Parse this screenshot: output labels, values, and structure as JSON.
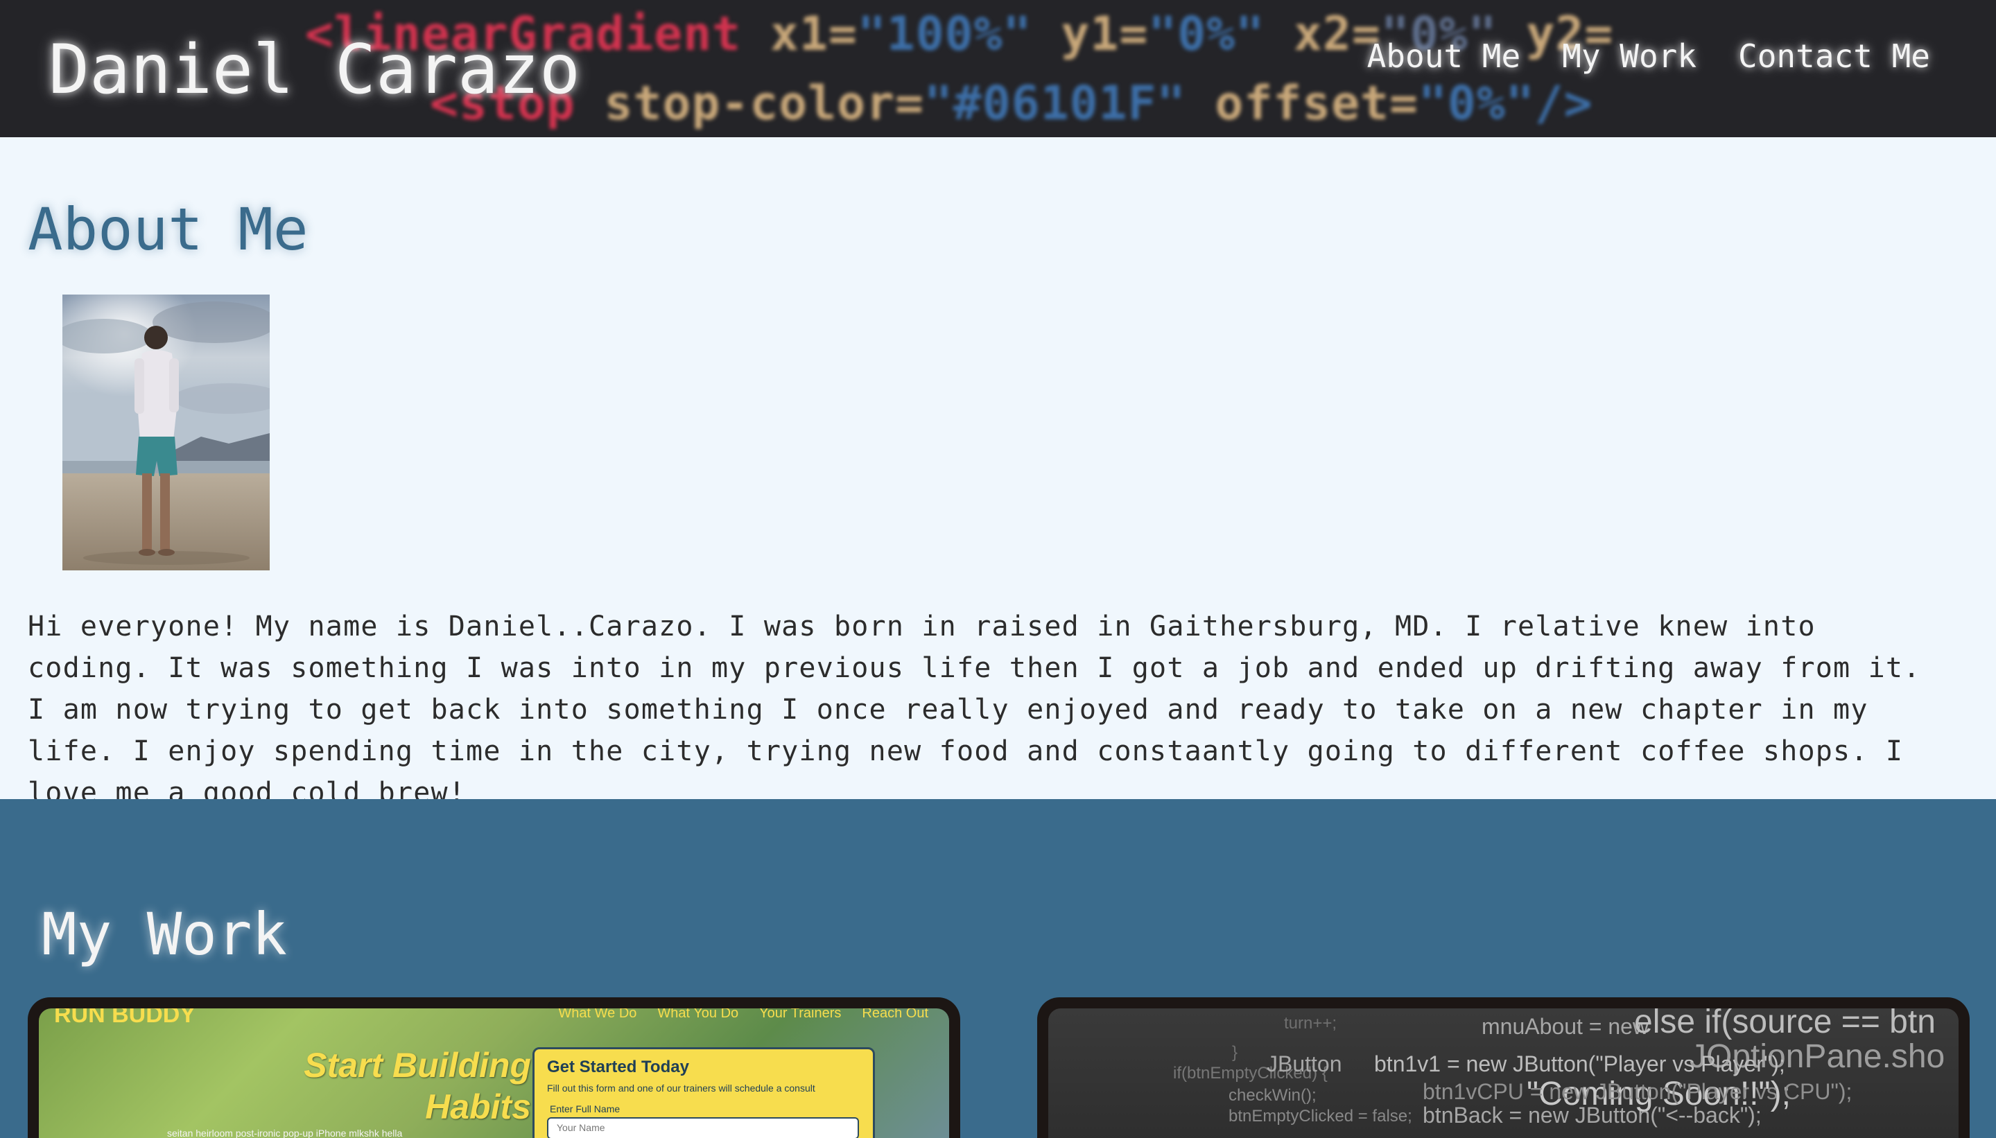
{
  "header": {
    "title": "Daniel Carazo",
    "nav": [
      "About Me",
      "My Work",
      "Contact Me"
    ],
    "bg_code": {
      "line1_tag": "<linearGradient",
      "line1_attr1": " x1=",
      "line1_val1": "\"100%\"",
      "line1_attr2": " y1=",
      "line1_val2": "\"0%\"",
      "line1_attr3": " x2=",
      "line1_val3": "\"0%\"",
      "line1_attr4": " y2=",
      "line2_tag": "<stop",
      "line2_attr1": " stop-color=",
      "line2_val1": "\"#06101F\"",
      "line2_attr2": " offset=",
      "line2_val2": "\"0%\"/>"
    }
  },
  "about": {
    "heading": "About Me",
    "bio": "Hi everyone! My name is Daniel..Carazo. I was born in raised in Gaithersburg, MD. I relative knew into coding. It was something I was into in my previous life then I got a job and ended up drifting away from it. I am now trying to get back into something I once really enjoyed and ready to take on a new chapter in my life. I enjoy spending time in the city, trying new food and constaantly going to different coffee shops. I love me a good cold brew!"
  },
  "work": {
    "heading": "My Work",
    "projects": [
      {
        "brand": "RUN BUDDY",
        "nav": [
          "What We Do",
          "What You Do",
          "Your Trainers",
          "Reach Out"
        ],
        "hero": "Start Building Habits",
        "sub_text": "seitan heirloom post-ironic pop-up iPhone mlkshk hella",
        "form_title": "Get Started Today",
        "form_sub": "Fill out this form and one of our trainers will schedule a consult",
        "form_label": "Enter Full Name",
        "form_placeholder": "Your Name"
      },
      {
        "code_lines": [
          "turn++;",
          "mnuAbout = new",
          "else if(source == btn",
          "JOptionPane.sho",
          "}",
          "if(btnEmptyClicked) {",
          "JButton",
          "btn1v1 = new JButton(\"Player vs Player\");",
          "\"Coming Soon!!\");",
          "checkWin();",
          "btn1vCPU = new JButton(\"Player vs CPU\");",
          "btnEmptyClicked = false;",
          "btnBack = new JButton(\"<--back\");"
        ]
      }
    ]
  },
  "colors": {
    "header_bg": "#242428",
    "about_bg": "#f0f7fd",
    "accent_blue": "#3a6b8c",
    "runbuddy_yellow": "#f7dd4e"
  }
}
